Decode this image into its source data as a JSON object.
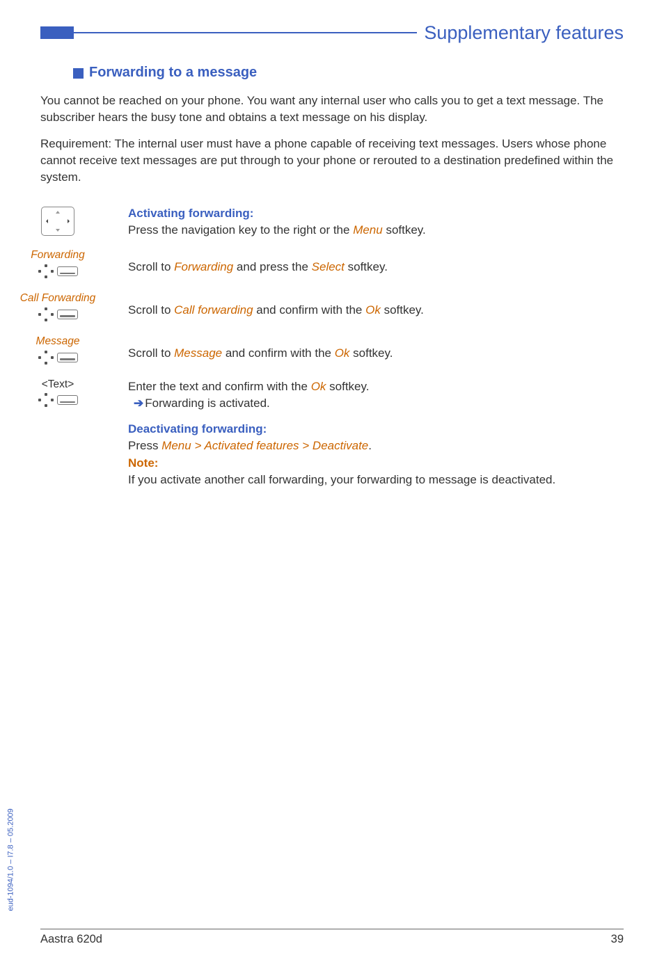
{
  "header": {
    "title": "Supplementary features"
  },
  "section": {
    "heading": "Forwarding to a message"
  },
  "intro": {
    "p1": "You cannot be reached on your phone. You want any internal user who calls you to get a text message. The subscriber hears the busy tone and obtains a text message on his display.",
    "p2": "Requirement: The internal user must have a phone capable of receiving text messages. Users whose phone cannot receive text messages are put through to your phone or rerouted to a destination predefined within the system."
  },
  "steps": {
    "s1": {
      "title": "Activating forwarding:",
      "text_a": "Press the navigation key to the right or the ",
      "menu": "Menu",
      "text_b": " softkey."
    },
    "s2": {
      "label": "Forwarding",
      "text_a": "Scroll to ",
      "t1": "Forwarding",
      "text_b": " and press the ",
      "t2": "Select",
      "text_c": " softkey."
    },
    "s3": {
      "label": "Call Forwarding",
      "text_a": "Scroll to ",
      "t1": "Call forwarding",
      "text_b": " and confirm with the ",
      "t2": "Ok",
      "text_c": " softkey."
    },
    "s4": {
      "label": "Message",
      "text_a": "Scroll to ",
      "t1": "Message",
      "text_b": " and confirm with the ",
      "t2": "Ok",
      "text_c": " softkey."
    },
    "s5": {
      "label": "<Text>",
      "text_a": "Enter the text and confirm with the ",
      "t1": "Ok",
      "text_b": " softkey.",
      "arrow_text": "Forwarding is activated."
    },
    "s6": {
      "title": "Deactivating forwarding:",
      "press": "Press ",
      "m1": "Menu",
      "gt1": " > ",
      "m2": "Activated features",
      "gt2": " > ",
      "m3": "Deactivate",
      "dot": ".",
      "note_label": "Note:",
      "note_text": "If you activate another call forwarding, your forwarding to message is deactivated."
    }
  },
  "footer": {
    "left": "Aastra 620d",
    "right": "39",
    "side": "eud-1094/1.0 – I7.8 – 05.2009"
  }
}
